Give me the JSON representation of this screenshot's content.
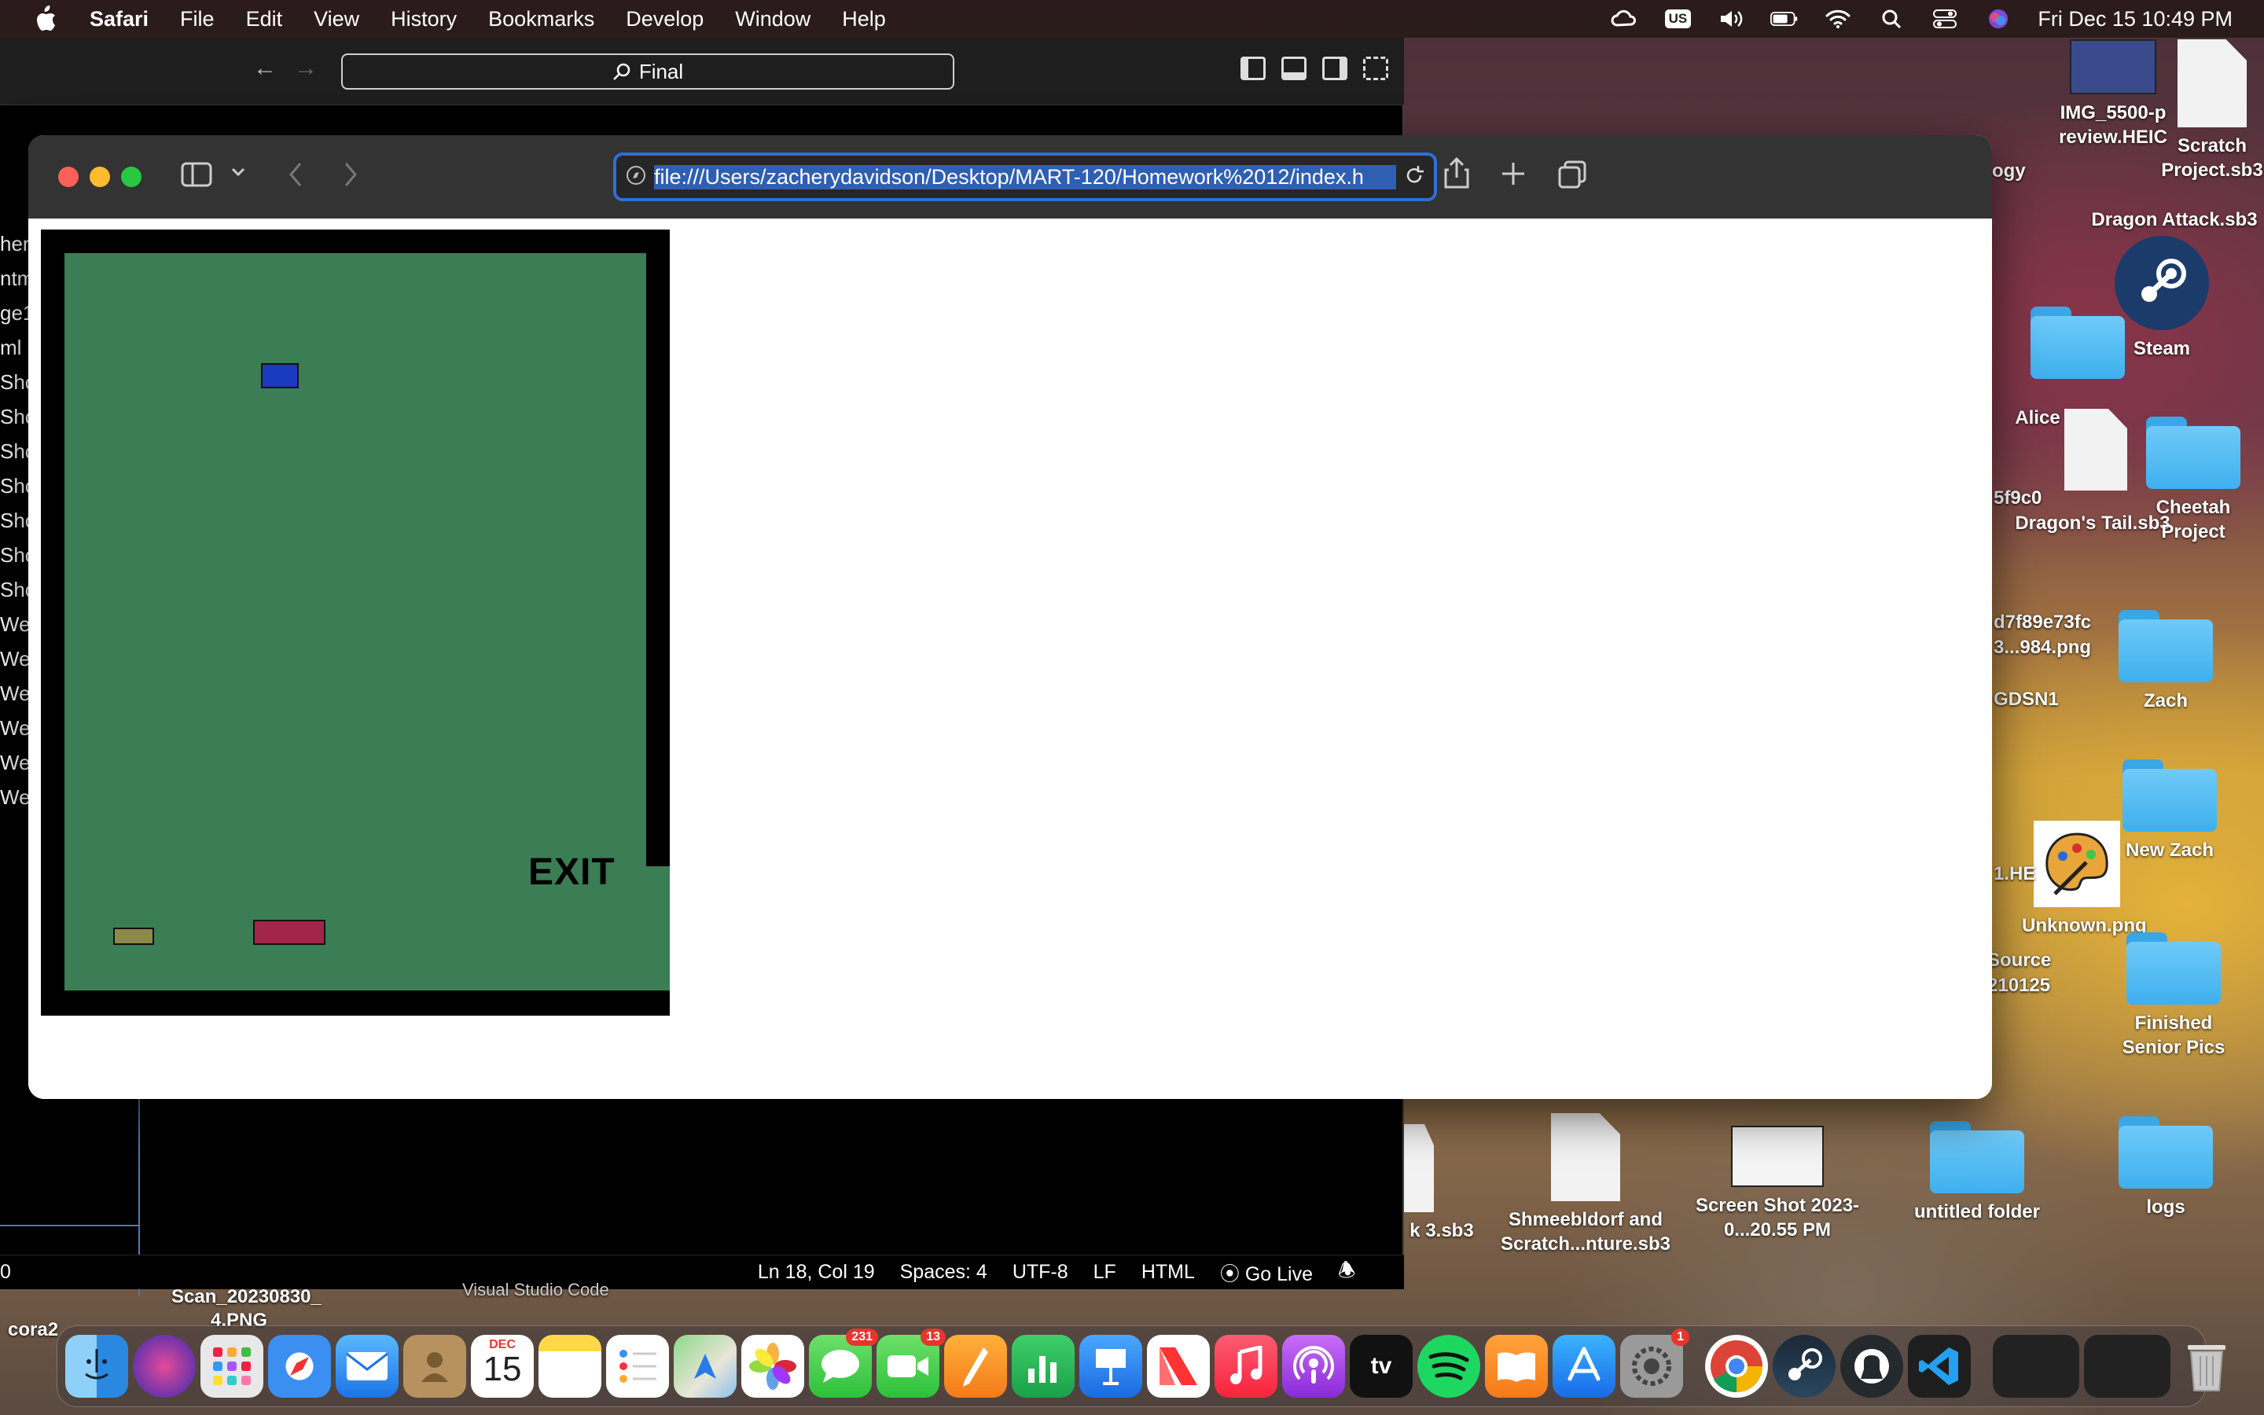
{
  "menubar": {
    "app": "Safari",
    "items": [
      "File",
      "Edit",
      "View",
      "History",
      "Bookmarks",
      "Develop",
      "Window",
      "Help"
    ],
    "input_badge": "US",
    "datetime": "Fri Dec 15  10:49 PM"
  },
  "vscode": {
    "search_text": "Final",
    "left_list": [
      "her",
      "ntm",
      "ge1",
      "ml",
      "Sho",
      "Sho",
      "Sho",
      "Sho",
      "Sho",
      "Sho",
      "Sho",
      "We",
      "We",
      "We",
      "We",
      "We",
      "We"
    ],
    "status": {
      "left": "0",
      "position": "Ln 18, Col 19",
      "spaces": "Spaces: 4",
      "encoding": "UTF-8",
      "eol": "LF",
      "language": "HTML",
      "golive": "Go Live"
    },
    "dock_caption": "Visual Studio Code"
  },
  "safari": {
    "url": "file:///Users/zacherydavidson/Desktop/MART-120/Homework%2012/index.h"
  },
  "game": {
    "exit_label": "EXIT",
    "colors": {
      "field": "#3b7d55",
      "player": "#1a3bbd",
      "enemy1": "#8c8a4a",
      "enemy2": "#a3254a",
      "wall": "#000000"
    }
  },
  "desktop": {
    "icons": [
      {
        "label": "IMG_5500-preview.HEIC"
      },
      {
        "label": "Scratch Project.sb3"
      },
      {
        "label": "Dragon Attack.sb3"
      },
      {
        "label": "Steam"
      },
      {
        "label": "Alice 3"
      },
      {
        "label": "Dragon's Tail.sb3"
      },
      {
        "label": "Cheetah Project"
      },
      {
        "label": "Zach"
      },
      {
        "label": "New Zach"
      },
      {
        "label": "Unknown.png"
      },
      {
        "label": "Finished Senior Pics"
      },
      {
        "label": "logs"
      },
      {
        "label": "untitled folder"
      },
      {
        "label": "Screen Shot 2023-0...20.55 PM"
      },
      {
        "label": "Shmeebldorf and Scratch...nture.sb3"
      },
      {
        "label": "k 3.sb3"
      }
    ],
    "partial_labels": [
      "ogy",
      "5f9c0",
      "d7f89e73fc",
      "3...984.png",
      "GDSN1",
      "1.HE",
      "Source",
      "210125"
    ],
    "bottom_left": [
      "Scan_20230830_",
      "4.PNG",
      "cora2"
    ]
  },
  "dock": {
    "calendar_month": "DEC",
    "calendar_day": "15",
    "messages_badge": "231",
    "facetime_badge": "13",
    "settings_badge": "1",
    "apps": [
      "finder-icon",
      "siri-icon",
      "launchpad-icon",
      "safari-icon",
      "mail-icon",
      "contacts-icon",
      "calendar-icon",
      "notes-icon",
      "reminders-icon",
      "maps-icon",
      "photos-icon",
      "messages-icon",
      "facetime-icon",
      "pages-icon",
      "numbers-icon",
      "keynote-icon",
      "news-icon",
      "music-icon",
      "podcasts-icon",
      "tv-icon",
      "spotify-icon",
      "books-icon",
      "appstore-icon",
      "settings-icon",
      "chrome-icon",
      "steam-icon",
      "github-icon",
      "vscode-icon"
    ],
    "tv_label": "tv"
  }
}
